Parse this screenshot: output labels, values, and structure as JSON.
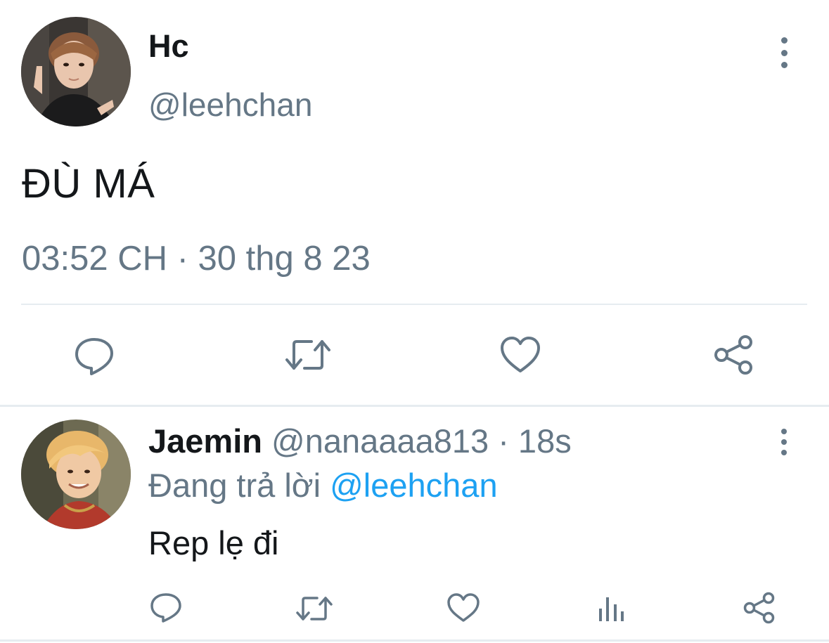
{
  "main_tweet": {
    "name": "Hc",
    "handle": "@leehchan",
    "text": "ĐÙ MÁ",
    "timestamp": "03:52 CH · 30 thg 8 23",
    "actions": [
      "reply-icon",
      "retweet-icon",
      "like-icon",
      "share-icon"
    ]
  },
  "reply_tweet": {
    "name": "Jaemin",
    "handle": "@nanaaaa813",
    "time": "· 18s",
    "replying_prefix": "Đang trả lời",
    "replying_to": "@leehchan",
    "text": "Rep lẹ đi",
    "actions": [
      "reply-icon",
      "retweet-icon",
      "like-icon",
      "analytics-icon",
      "share-icon"
    ]
  },
  "colors": {
    "text": "#14171a",
    "secondary": "#657786",
    "link": "#1da1f2",
    "divider": "#e6ecf0"
  }
}
